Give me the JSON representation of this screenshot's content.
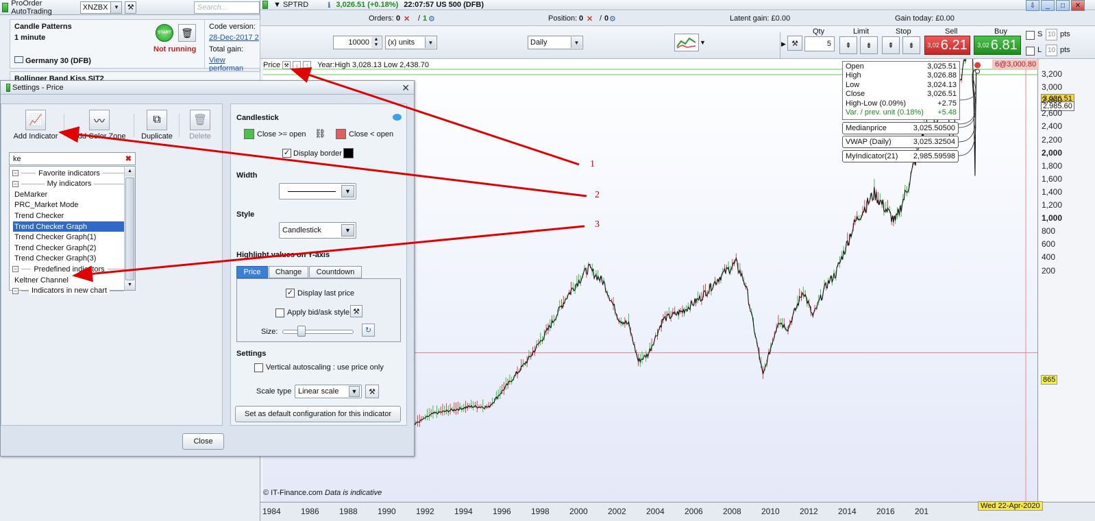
{
  "left_panel": {
    "title": "ProOrder AutoTrading",
    "account": "XNZBX",
    "search_placeholder": "Search...",
    "strategy1": {
      "name_partial": "Candle Patterns",
      "timeframe": "1 minute",
      "status": "Not running",
      "market": "Germany 30 (DFB)",
      "code_version_label": "Code version:",
      "code_version_link": "28-Dec-2017 2",
      "total_gain_label": "Total gain:",
      "view_performance": "View performan"
    },
    "strategy2": {
      "name_partial": "Bollinger Band Kiss SIT2"
    },
    "start_label": "START"
  },
  "chart_header": {
    "symbol": "SPTRD",
    "price_change": "3,026.51 (+0.18%)",
    "time_name": "22:07:57 US 500 (DFB)",
    "orders_label": "Orders:",
    "orders_a": "0",
    "orders_b": "1",
    "position_label": "Position:",
    "position_a": "0",
    "position_b": "0",
    "latent_gain": "Latent gain: £0.00",
    "gain_today": "Gain today: £0.00"
  },
  "order_toolbar": {
    "quantity": "10000",
    "unit": "(x) units",
    "timeframe": "Daily",
    "qty_label": "Qty",
    "qty_value": "5",
    "limit_label": "Limit",
    "stop_label": "Stop",
    "sell_label": "Sell",
    "buy_label": "Buy",
    "sell_prefix": "3,02",
    "sell_price": "6.21",
    "buy_prefix": "3,02",
    "buy_price": "6.81",
    "s_label": "S",
    "l_label": "L",
    "s_pts": "10",
    "l_pts": "10",
    "pts_label": "pts"
  },
  "chart": {
    "price_label": "Price",
    "year_range": "Year:High 3,028.13 Low 2,438.70",
    "order_tag": "6@3,000.80",
    "ohlc": [
      {
        "label": "Open",
        "value": "3,025.51"
      },
      {
        "label": "High",
        "value": "3,026.88"
      },
      {
        "label": "Low",
        "value": "3,024.13"
      },
      {
        "label": "Close",
        "value": "3,026.51"
      },
      {
        "label": "High-Low (0.09%)",
        "value": "+2.75"
      },
      {
        "label": "Var. / prev. unit (0.18%)",
        "value": "+5.48"
      }
    ],
    "indicators": [
      {
        "label": "Medianprice",
        "value": "3,025.50500"
      },
      {
        "label": "VWAP (Daily)",
        "value": "3,025.32504"
      },
      {
        "label": "MyIndicator(21)",
        "value": "2,985.59598"
      }
    ],
    "last_price_tag": "3,026.51",
    "second_tag": "2,985.60",
    "hline_tag": "865",
    "y_ticks": [
      "3,200",
      "3,000",
      "2,800",
      "2,600",
      "2,400",
      "2,200",
      "2,000",
      "1,800",
      "1,600",
      "1,400",
      "1,200",
      "1,000",
      "800",
      "600",
      "400",
      "200"
    ],
    "x_ticks": [
      "1984",
      "1986",
      "1988",
      "1990",
      "1992",
      "1994",
      "1996",
      "1998",
      "2000",
      "2002",
      "2004",
      "2006",
      "2008",
      "2010",
      "2012",
      "2014",
      "2016",
      "201"
    ],
    "date_tag": "Wed 22-Apr-2020",
    "copyright": "© IT-Finance.com",
    "disclaimer": "Data is indicative"
  },
  "dialog": {
    "title": "Settings - Price",
    "tools": {
      "add_indicator": "Add Indicator",
      "add_color_zone": "Add Color Zone",
      "duplicate": "Duplicate",
      "delete": "Delete"
    },
    "search_value": "ke",
    "list": {
      "favorite_group": "Favorite indicators",
      "my_group": "My indicators",
      "items": [
        "DeMarker",
        "PRC_Market Mode",
        "Trend Checker",
        "Trend Checker Graph",
        "Trend Checker Graph(1)",
        "Trend Checker Graph(2)",
        "Trend Checker Graph(3)"
      ],
      "predefined_group": "Predefined indicators",
      "keltner": "Keltner Channel",
      "new_chart_group": "Indicators in new chart"
    },
    "candlestick_title": "Candlestick",
    "close_up_label": "Close >= open",
    "close_down_label": "Close < open",
    "display_border": "Display border",
    "width_title": "Width",
    "style_title": "Style",
    "style_value": "Candlestick",
    "highlight_title": "Highlight values on Y-axis",
    "tabs": [
      "Price",
      "Change",
      "Countdown"
    ],
    "display_last_price": "Display last price",
    "apply_bid_ask": "Apply bid/ask style",
    "size_label": "Size:",
    "settings_title": "Settings",
    "vertical_autoscaling": "Vertical autoscaling : use price only",
    "scale_type_label": "Scale type",
    "scale_type_value": "Linear scale",
    "set_default": "Set as default configuration for this indicator",
    "close_button": "Close"
  },
  "annotations": [
    "1",
    "2",
    "3"
  ],
  "colors": {
    "close_up": "#4cc24c",
    "close_down": "#e06060",
    "sell": "#d83a3a",
    "buy": "#2e9b2e",
    "arrow": "#e00000",
    "selected": "#316ac5"
  }
}
